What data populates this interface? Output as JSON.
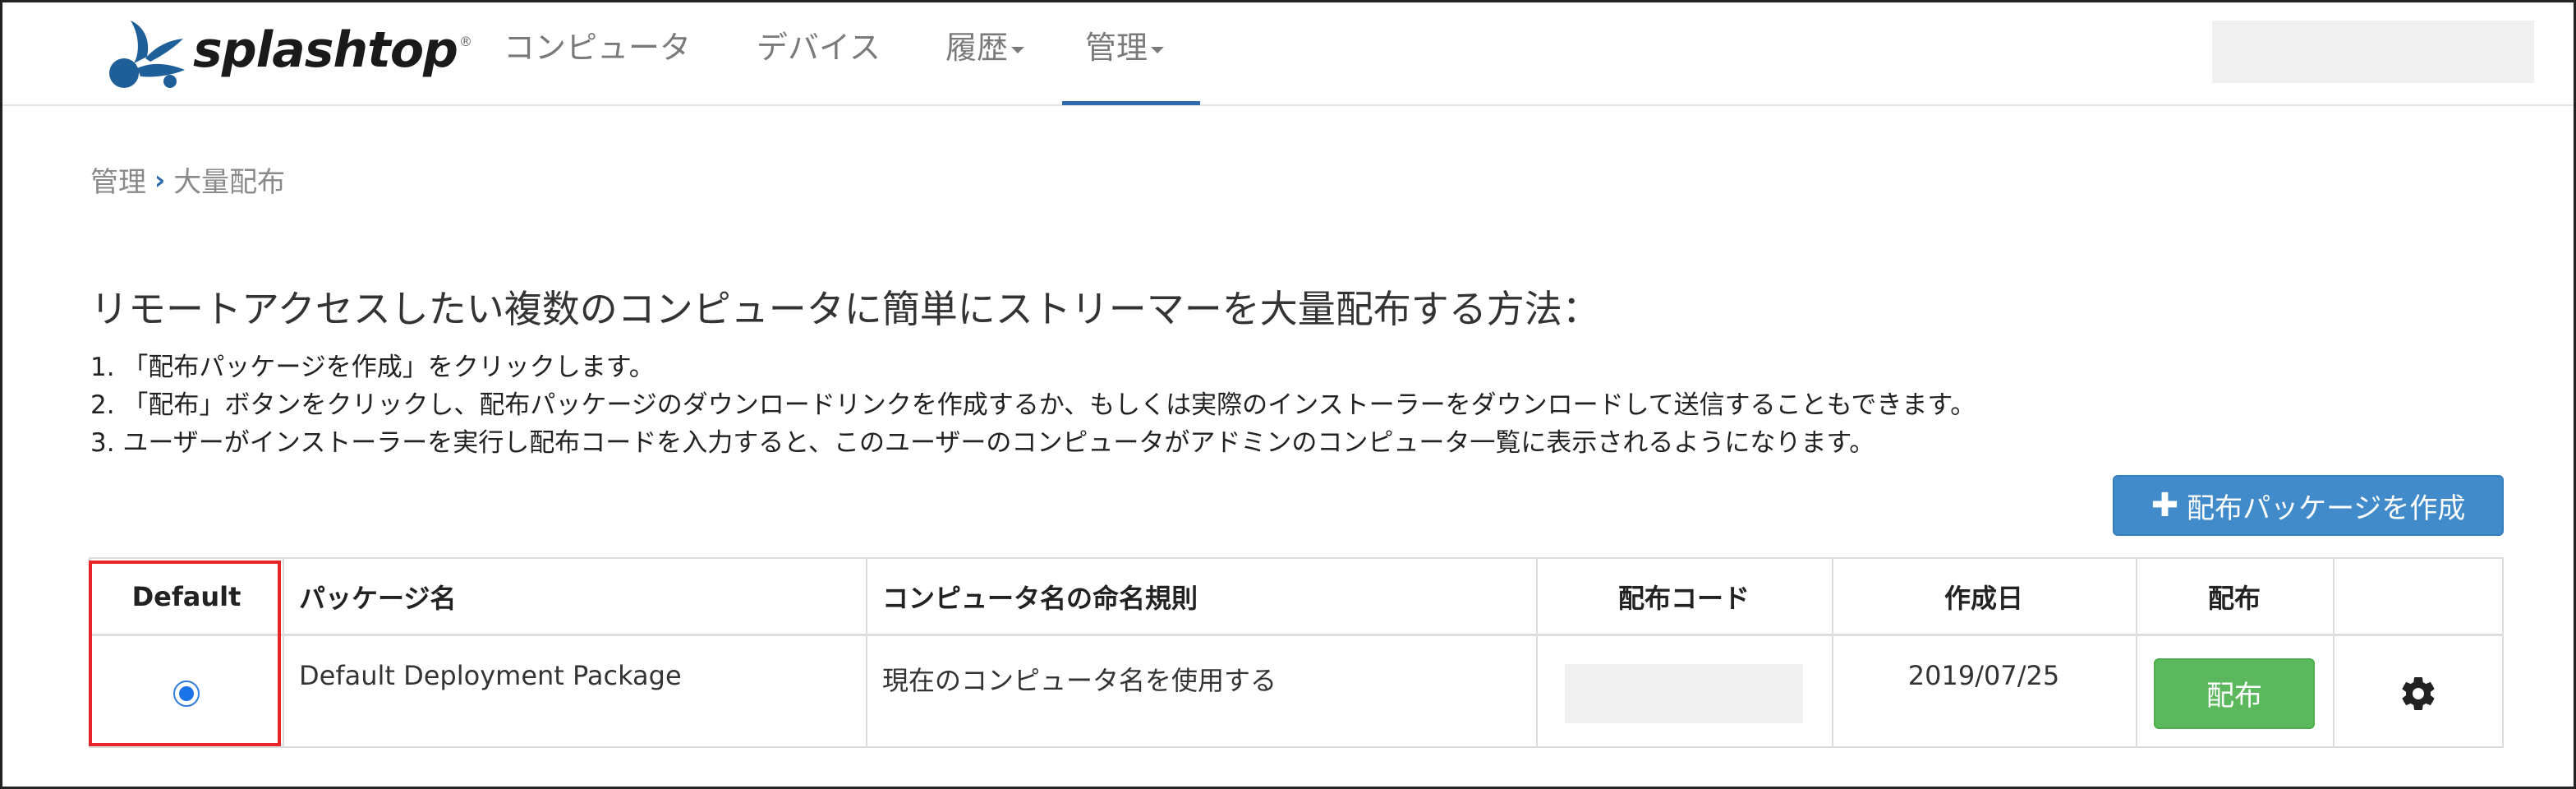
{
  "brand": {
    "name": "splashtop",
    "reg": "®"
  },
  "nav": {
    "computers": "コンピュータ",
    "devices": "デバイス",
    "history": "履歴",
    "admin": "管理"
  },
  "breadcrumb": {
    "parent": "管理",
    "separator": "›",
    "current": "大量配布"
  },
  "intro": {
    "heading": "リモートアクセスしたい複数のコンピュータに簡単にストリーマーを大量配布する方法：",
    "steps": [
      "1. 「配布パッケージを作成」をクリックします。",
      "2. 「配布」ボタンをクリックし、配布パッケージのダウンロードリンクを作成するか、もしくは実際のインストーラーをダウンロードして送信することもできます。",
      "3. ユーザーがインストーラーを実行し配布コードを入力すると、このユーザーのコンピュータがアドミンのコンピュータ一覧に表示されるようになります。"
    ]
  },
  "create_button": {
    "icon": "plus-icon",
    "label": "配布パッケージを作成"
  },
  "table": {
    "headers": {
      "default": "Default",
      "package_name": "パッケージ名",
      "naming_rule": "コンピュータ名の命名規則",
      "deploy_code": "配布コード",
      "created": "作成日",
      "deploy": "配布"
    },
    "rows": [
      {
        "selected": true,
        "package_name": "Default Deployment Package",
        "naming_rule": "現在のコンピュータ名を使用する",
        "created": "2019/07/25",
        "deploy_label": "配布",
        "settings_icon": "gear-icon"
      }
    ]
  },
  "colors": {
    "primary": "#428bca",
    "success": "#5cb85c",
    "highlight": "#e8242b",
    "nav_active": "#2f6cb0"
  }
}
